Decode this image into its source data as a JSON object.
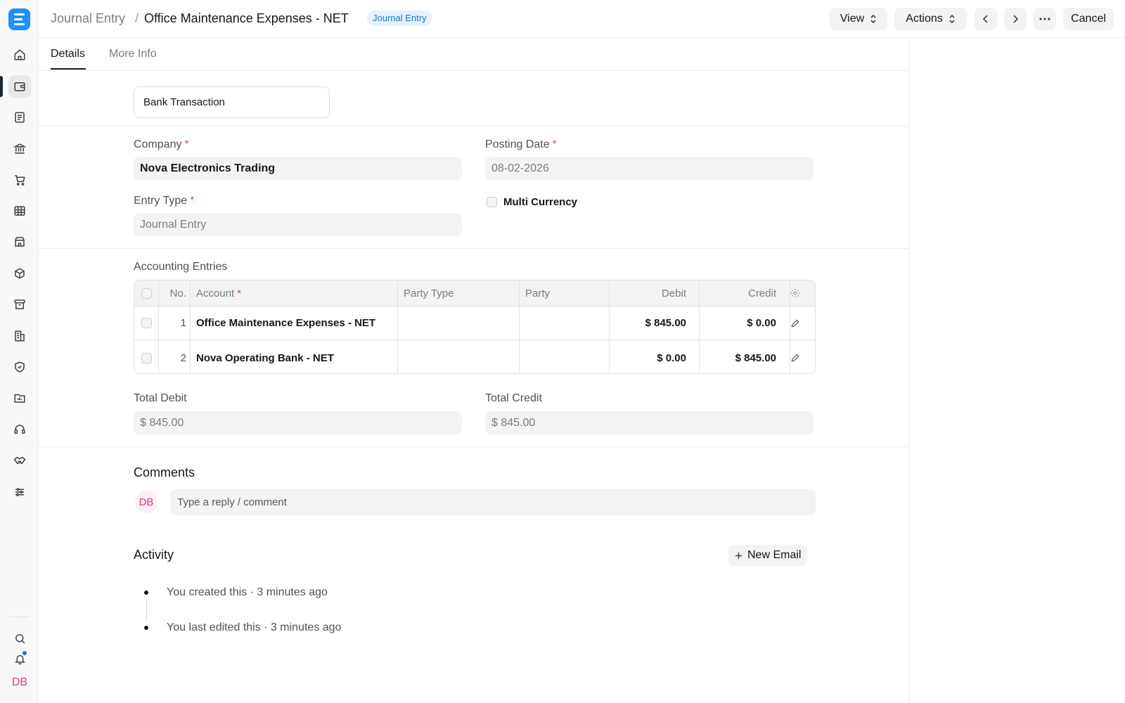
{
  "rail": {
    "logo_letter": "E",
    "items": [
      "home-icon",
      "wallet-icon",
      "file-text-icon",
      "bank-icon",
      "cart-icon",
      "table-icon",
      "store-icon",
      "package-icon",
      "archive-icon",
      "buildings-icon",
      "shield-icon",
      "folder-chart-icon",
      "headset-icon",
      "handshake-icon",
      "sliders-icon"
    ],
    "active_item": "wallet-icon",
    "user_initials": "DB"
  },
  "header": {
    "breadcrumb_parent": "Journal Entry",
    "breadcrumb_separator": "/",
    "title": "Office Maintenance Expenses - NET",
    "doctype_badge": "Journal Entry",
    "view_label": "View",
    "actions_label": "Actions",
    "cancel_label": "Cancel"
  },
  "tabs": [
    {
      "label": "Details",
      "active": true
    },
    {
      "label": "More Info",
      "active": false
    }
  ],
  "form": {
    "voucher_type_value": "Bank Transaction",
    "company_label": "Company",
    "company_value": "Nova Electronics Trading",
    "posting_date_label": "Posting Date",
    "posting_date_value": "08-02-2026",
    "entry_type_label": "Entry Type",
    "entry_type_value": "Journal Entry",
    "multi_currency_label": "Multi Currency",
    "required_mark": "*"
  },
  "accounts_table": {
    "title": "Accounting Entries",
    "columns": {
      "no": "No.",
      "account": "Account",
      "party_type": "Party Type",
      "party": "Party",
      "debit": "Debit",
      "credit": "Credit"
    },
    "rows": [
      {
        "no": "1",
        "account": "Office Maintenance Expenses - NET",
        "party_type": "",
        "party": "",
        "debit": "$ 845.00",
        "credit": "$ 0.00"
      },
      {
        "no": "2",
        "account": "Nova Operating Bank - NET",
        "party_type": "",
        "party": "",
        "debit": "$ 0.00",
        "credit": "$ 845.00"
      }
    ]
  },
  "totals": {
    "total_debit_label": "Total Debit",
    "total_debit_value": "$ 845.00",
    "total_credit_label": "Total Credit",
    "total_credit_value": "$ 845.00"
  },
  "comments": {
    "title": "Comments",
    "avatar_initials": "DB",
    "placeholder": "Type a reply / comment"
  },
  "activity": {
    "title": "Activity",
    "new_email_label": "New Email",
    "items": [
      "You created this · 3 minutes ago",
      "You last edited this · 3 minutes ago"
    ]
  },
  "colors": {
    "brand": "#1e90ff",
    "badge_bg": "#e6f1fd",
    "badge_text": "#1579d0",
    "required": "#e24c4c",
    "avatar": "#e0368d",
    "notification_dot": "#1e6fd9"
  }
}
